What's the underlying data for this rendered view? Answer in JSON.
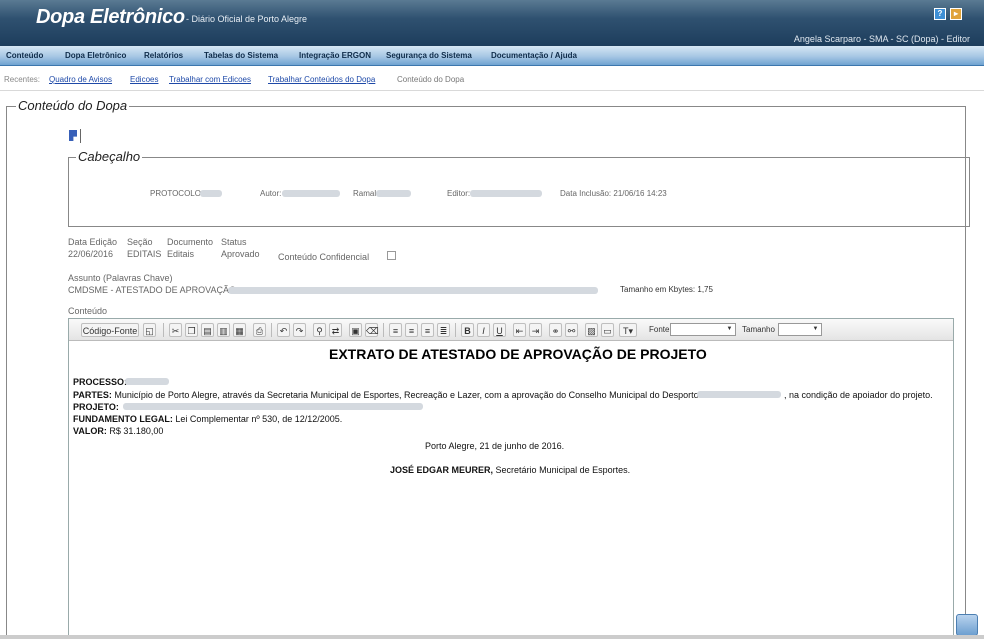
{
  "header": {
    "brand": "Dopa Eletrônico",
    "subtitle": "- Diário Oficial de Porto Alegre",
    "user": "Angela Scarparo - SMA - SC (Dopa) - Editor",
    "help_icon": "?",
    "exit_icon": "▸"
  },
  "menu": [
    "Conteúdo",
    "Dopa Eletrônico",
    "Relatórios",
    "Tabelas do Sistema",
    "Integração ERGON",
    "Segurança do Sistema",
    "Documentação / Ajuda"
  ],
  "recent": {
    "label": "Recentes:",
    "links": [
      "Quadro de Avisos",
      "Edicoes",
      "Trabalhar com Edicoes",
      "Trabalhar Conteúdos do Dopa"
    ],
    "current": "Conteúdo do Dopa"
  },
  "main": {
    "legend": "Conteúdo do Dopa",
    "cabecalho": {
      "legend": "Cabeçalho",
      "protocolo_label": "PROTOCOLO:",
      "autor_label": "Autor:",
      "ramal_label": "Ramal:",
      "editor_label": "Editor:",
      "data_inclusao": "Data Inclusão: 21/06/16 14:23"
    },
    "meta": {
      "data_edicao_label": "Data Edição",
      "data_edicao_value": "22/06/2016",
      "secao_label": "Seção",
      "secao_value": "EDITAIS",
      "documento_label": "Documento",
      "documento_value": "Editais",
      "status_label": "Status",
      "status_value": "Aprovado",
      "confidencial_label": "Conteúdo Confidencial"
    },
    "assunto_label": "Assunto (Palavras Chave)",
    "assunto_value": "CMDSME - ATESTADO DE APROVAÇÃO",
    "tamanho": "Tamanho em Kbytes: 1,75",
    "conteudo_label": "Conteúdo"
  },
  "toolbar": {
    "codigo_fonte": "Código-Fonte",
    "fonte_label": "Fonte",
    "tamanho_label": "Tamanho",
    "bold": "B",
    "italic": "I",
    "underline": "U"
  },
  "document": {
    "title": "EXTRATO DE ATESTADO DE APROVAÇÃO DE PROJETO",
    "processo_label": "PROCESSO:",
    "partes_label": "PARTES:",
    "partes_text": "Município de Porto Alegre, através da Secretaria Municipal de Esportes, Recreação e Lazer, com a aprovação do Conselho Municipal do Desporto e",
    "partes_end": ", na condição de apoiador do projeto.",
    "projeto_label": "PROJETO:",
    "fundamento_label": "FUNDAMENTO LEGAL:",
    "fundamento_text": "Lei Complementar nº 530, de 12/12/2005.",
    "valor_label": "VALOR:",
    "valor_text": "R$ 31.180,00",
    "place_date": "Porto Alegre, 21 de junho de 2016.",
    "signer": "JOSÉ EDGAR MEURER,",
    "signer_role": "Secretário Municipal de Esportes."
  }
}
